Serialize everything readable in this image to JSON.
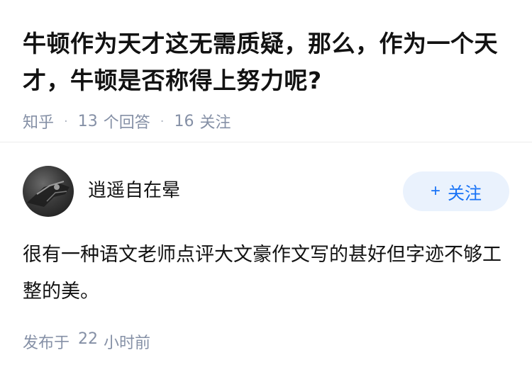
{
  "question": {
    "title": "牛顿作为天才这无需质疑，那么，作为一个天才，牛顿是否称得上努力呢?",
    "source": "知乎",
    "answers_count": "13",
    "answers_label": "个回答",
    "followers_count": "16",
    "followers_label": "关注"
  },
  "answer": {
    "author_name": "逍遥自在晕",
    "follow_label": "关注",
    "follow_icon": "plus-icon",
    "content": "很有一种语文老师点评大文豪作文写的甚好但字迹不够工整的美。",
    "posted_prefix": "发布于",
    "posted_number": "22",
    "posted_unit": "小时前"
  },
  "colors": {
    "accent": "#1772f6",
    "accent_bg": "#eaf2fd",
    "meta_text": "#8590a6"
  }
}
